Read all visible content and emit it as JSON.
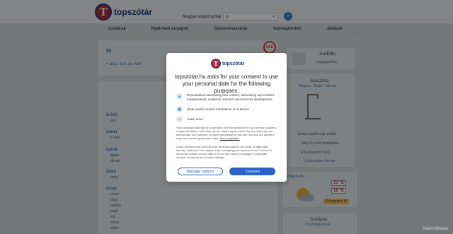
{
  "header": {
    "logo_mark": "T",
    "logo_text": "topszótár",
    "dictionary_selected": "Magyar-angol szótár",
    "search_value": "is",
    "clear_glyph": "✕",
    "search_glyph": "⌕"
  },
  "nav": {
    "items": [
      "Szótárak",
      "Nyelvtani anyagok",
      "Szinonimaszótár",
      "Szövegfordító",
      "Játékok"
    ]
  },
  "entry": {
    "word": "is",
    "translation": "+ also, too, as well",
    "badge": "24h"
  },
  "groups": [
    {
      "title": "is-ből",
      "items": [
        "alto"
      ]
    },
    {
      "title": "ismer",
      "items": [
        "to ken"
      ]
    },
    {
      "title": "ismét",
      "items": [
        "again",
        "afresh"
      ]
    },
    {
      "title": "isten",
      "items": [
        "deity"
      ]
    },
    {
      "title": "iszap",
      "items": [
        "dross",
        "ooze",
        "puddle",
        "pash",
        "silt",
        "slush",
        "slime"
      ]
    }
  ],
  "sidebar": {
    "sudoku_title": "Sudoku",
    "sudoku_link": "megogyel.hu",
    "hangman_title": "Akasztófa",
    "hangman_sub": "Magyar - Angol - Német",
    "hangman_lines": [
      "Ezek a betűk már voltak:",
      "Még 11 szót hibázhatsz.",
      "A kiválasztott betű:",
      "Új feladvány kérése"
    ],
    "weather_title": "Időjárás.hu",
    "weather_max": "31 °C",
    "weather_min": "19 °C",
    "weather_link": "Előrejelzés fő",
    "sayings_title": "Szólások",
    "sayings_link": "Új szólást kérek"
  },
  "dialog": {
    "logo_mark": "T",
    "logo_text": "topszótár",
    "title": "topszotar.hu asks for your consent to use your personal data for the following purposes:",
    "purposes": [
      {
        "icon": "person-icon",
        "glyph": "●",
        "text": "Personalised advertising and content, advertising and content measurement, audience research and services development"
      },
      {
        "icon": "device-icon",
        "glyph": "▣",
        "text": "Store and/or access information on a device"
      },
      {
        "icon": "chevron-down-icon",
        "glyph": "⌄",
        "text": "Learn more"
      }
    ],
    "para1": "Your personal data will be processed and information from your device (cookies, unique identifiers, and other device data) may be stored by, accessed by and shared with 216 partners, or used specifically by this site. We and our partners may use precise geolocation data.",
    "para1_link": "List of partners.",
    "para2": "Some vendors may process your personal data on the basis of legitimate interest, which you can object to by managing your options below. Look for a link at the bottom of this page or in our site menu to manage or withdraw consent in privacy and cookie settings.",
    "manage_label": "Manage options",
    "consent_label": "Consent"
  },
  "watermark": "SketchMaster"
}
